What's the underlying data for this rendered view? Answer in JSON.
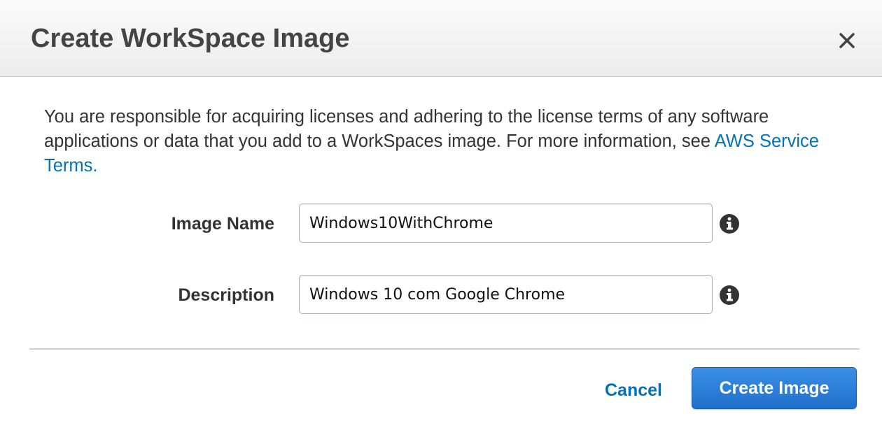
{
  "dialog": {
    "title": "Create WorkSpace Image",
    "close_icon": "close-icon"
  },
  "notice": {
    "text": "You are responsible for acquiring licenses and adhering to the license terms of any software applications or data that you add to a WorkSpaces image. For more information, see ",
    "link_text": "AWS Service Terms."
  },
  "form": {
    "image_name": {
      "label": "Image Name",
      "value": "Windows10WithChrome",
      "info_icon": "info-icon"
    },
    "description": {
      "label": "Description",
      "value": "Windows 10 com Google Chrome",
      "info_icon": "info-icon"
    }
  },
  "footer": {
    "cancel_label": "Cancel",
    "create_label": "Create Image"
  },
  "colors": {
    "link": "#0073bb",
    "primary_button": "#2a7fdc",
    "header_bg": "#f2f2f2",
    "text": "#333333"
  }
}
